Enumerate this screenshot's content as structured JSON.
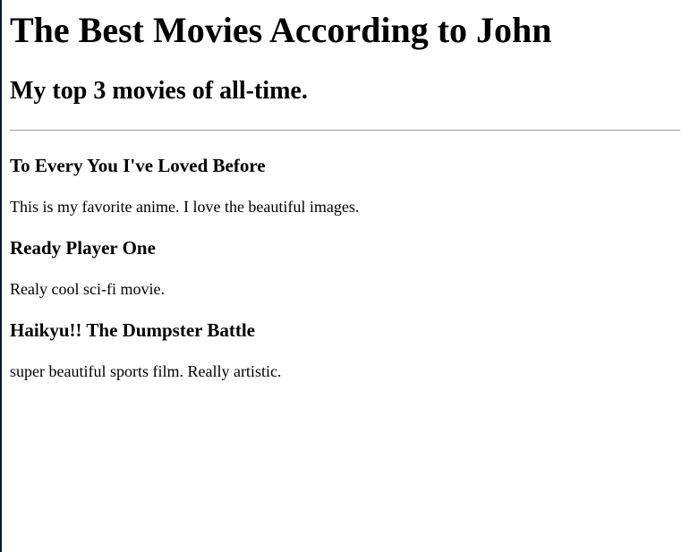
{
  "page": {
    "title": "The Best Movies According to John",
    "subtitle": "My top 3 movies of all-time."
  },
  "movies": [
    {
      "title": "To Every You I've Loved Before",
      "description": "This is my favorite anime. I love the beautiful images."
    },
    {
      "title": "Ready Player One",
      "description": "Realy cool sci-fi movie."
    },
    {
      "title": "Haikyu!! The Dumpster Battle",
      "description": "super beautiful sports film. Really artistic."
    }
  ]
}
